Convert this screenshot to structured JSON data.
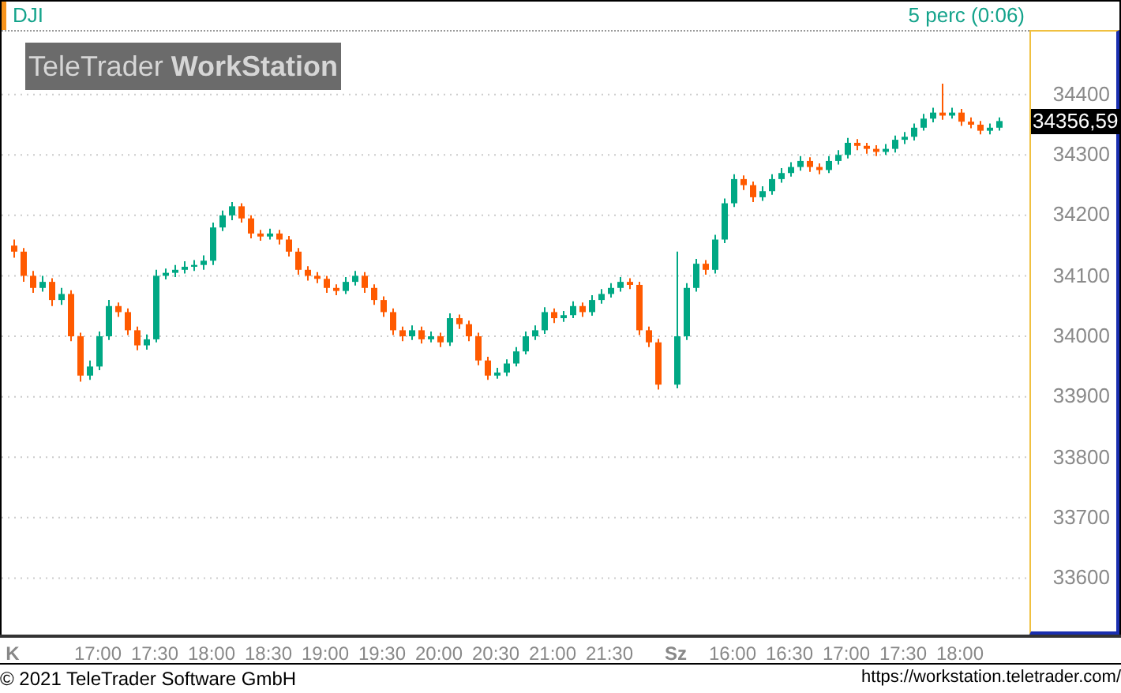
{
  "header": {
    "symbol": "DJI",
    "interval": "5 perc (0:06)"
  },
  "logo": {
    "brand": "TeleTrader",
    "product": "WorkStation"
  },
  "chart_data": {
    "type": "candlestick",
    "grid": true,
    "ylim": [
      33507,
      34504
    ],
    "categories": [
      "K",
      null,
      null,
      null,
      null,
      null,
      null,
      null,
      null,
      "17:00",
      null,
      null,
      null,
      null,
      null,
      "17:30",
      null,
      null,
      null,
      null,
      null,
      "18:00",
      null,
      null,
      null,
      null,
      null,
      "18:30",
      null,
      null,
      null,
      null,
      null,
      "19:00",
      null,
      null,
      null,
      null,
      null,
      "19:30",
      null,
      null,
      null,
      null,
      null,
      "20:00",
      null,
      null,
      null,
      null,
      null,
      "20:30",
      null,
      null,
      null,
      null,
      null,
      "21:00",
      null,
      null,
      null,
      null,
      null,
      "21:30",
      null,
      null,
      null,
      null,
      null,
      null,
      "Sz",
      null,
      null,
      null,
      null,
      null,
      "16:00",
      null,
      null,
      null,
      null,
      null,
      "16:30",
      null,
      null,
      null,
      null,
      null,
      "17:00",
      null,
      null,
      null,
      null,
      null,
      "17:30",
      null,
      null,
      null,
      null,
      null,
      "18:00",
      null,
      null,
      null,
      null
    ],
    "yticks": [
      {
        "value": 33600,
        "label": "33600"
      },
      {
        "value": 33700,
        "label": "33700"
      },
      {
        "value": 33800,
        "label": "33800"
      },
      {
        "value": 33900,
        "label": "33900"
      },
      {
        "value": 34000,
        "label": "34000"
      },
      {
        "value": 34100,
        "label": "34100"
      },
      {
        "value": 34200,
        "label": "34200"
      },
      {
        "value": 34300,
        "label": "34300"
      },
      {
        "value": 34400,
        "label": "34400"
      }
    ],
    "ohlc": [
      [
        34150,
        34160,
        34130,
        34140
      ],
      [
        34140,
        34146,
        34090,
        34100
      ],
      [
        34100,
        34108,
        34072,
        34080
      ],
      [
        34080,
        34100,
        34074,
        34090
      ],
      [
        34090,
        34096,
        34050,
        34060
      ],
      [
        34060,
        34080,
        34052,
        34070
      ],
      [
        34070,
        34076,
        33992,
        34000
      ],
      [
        34000,
        34006,
        33925,
        33935
      ],
      [
        33935,
        33960,
        33928,
        33950
      ],
      [
        33950,
        34008,
        33944,
        34000
      ],
      [
        34000,
        34060,
        33994,
        34050
      ],
      [
        34050,
        34056,
        34032,
        34040
      ],
      [
        34040,
        34046,
        34002,
        34010
      ],
      [
        34010,
        34016,
        33977,
        33985
      ],
      [
        33985,
        34003,
        33978,
        33995
      ],
      [
        33995,
        34110,
        33990,
        34100
      ],
      [
        34100,
        34112,
        34094,
        34105
      ],
      [
        34105,
        34118,
        34098,
        34110
      ],
      [
        34110,
        34124,
        34104,
        34115
      ],
      [
        34115,
        34126,
        34108,
        34118
      ],
      [
        34118,
        34134,
        34110,
        34125
      ],
      [
        34125,
        34188,
        34118,
        34180
      ],
      [
        34180,
        34208,
        34174,
        34200
      ],
      [
        34200,
        34222,
        34192,
        34215
      ],
      [
        34215,
        34220,
        34188,
        34195
      ],
      [
        34195,
        34200,
        34162,
        34170
      ],
      [
        34170,
        34176,
        34158,
        34165
      ],
      [
        34165,
        34178,
        34160,
        34170
      ],
      [
        34170,
        34176,
        34152,
        34160
      ],
      [
        34160,
        34166,
        34132,
        34140
      ],
      [
        34140,
        34146,
        34102,
        34110
      ],
      [
        34110,
        34116,
        34092,
        34100
      ],
      [
        34100,
        34106,
        34088,
        34095
      ],
      [
        34095,
        34100,
        34072,
        34080
      ],
      [
        34080,
        34086,
        34068,
        34075
      ],
      [
        34075,
        34098,
        34070,
        34090
      ],
      [
        34090,
        34108,
        34084,
        34100
      ],
      [
        34100,
        34106,
        34072,
        34080
      ],
      [
        34080,
        34086,
        34052,
        34060
      ],
      [
        34060,
        34066,
        34032,
        34040
      ],
      [
        34040,
        34046,
        34002,
        34010
      ],
      [
        34010,
        34016,
        33992,
        34000
      ],
      [
        34000,
        34018,
        33994,
        34010
      ],
      [
        34010,
        34016,
        33988,
        33995
      ],
      [
        33995,
        34008,
        33990,
        34000
      ],
      [
        34000,
        34006,
        33982,
        33990
      ],
      [
        33990,
        34038,
        33984,
        34030
      ],
      [
        34030,
        34036,
        34012,
        34020
      ],
      [
        34020,
        34026,
        33992,
        34000
      ],
      [
        34000,
        34006,
        33952,
        33960
      ],
      [
        33960,
        33966,
        33928,
        33935
      ],
      [
        33935,
        33948,
        33930,
        33940
      ],
      [
        33940,
        33962,
        33934,
        33955
      ],
      [
        33955,
        33982,
        33950,
        33975
      ],
      [
        33975,
        34008,
        33970,
        34000
      ],
      [
        34000,
        34018,
        33994,
        34010
      ],
      [
        34010,
        34048,
        34004,
        34040
      ],
      [
        34040,
        34046,
        34022,
        34030
      ],
      [
        34030,
        34042,
        34024,
        34035
      ],
      [
        34035,
        34058,
        34030,
        34050
      ],
      [
        34050,
        34056,
        34032,
        34040
      ],
      [
        34040,
        34068,
        34034,
        34060
      ],
      [
        34060,
        34078,
        34054,
        34070
      ],
      [
        34070,
        34088,
        34064,
        34080
      ],
      [
        34080,
        34098,
        34074,
        34090
      ],
      [
        34090,
        34096,
        34078,
        34085
      ],
      [
        34085,
        34090,
        34002,
        34010
      ],
      [
        34010,
        34016,
        33982,
        33990
      ],
      [
        33990,
        33996,
        33912,
        33920
      ],
      null,
      [
        33920,
        34140,
        33914,
        34000
      ],
      [
        34000,
        34088,
        33994,
        34080
      ],
      [
        34080,
        34128,
        34074,
        34120
      ],
      [
        34120,
        34126,
        34102,
        34110
      ],
      [
        34110,
        34168,
        34104,
        34160
      ],
      [
        34160,
        34228,
        34154,
        34220
      ],
      [
        34220,
        34268,
        34214,
        34260
      ],
      [
        34260,
        34266,
        34242,
        34250
      ],
      [
        34250,
        34256,
        34222,
        34230
      ],
      [
        34230,
        34248,
        34224,
        34240
      ],
      [
        34240,
        34268,
        34234,
        34260
      ],
      [
        34260,
        34278,
        34254,
        34270
      ],
      [
        34270,
        34288,
        34264,
        34280
      ],
      [
        34280,
        34298,
        34274,
        34290
      ],
      [
        34290,
        34296,
        34272,
        34280
      ],
      [
        34280,
        34286,
        34268,
        34275
      ],
      [
        34275,
        34298,
        34270,
        34290
      ],
      [
        34290,
        34308,
        34284,
        34300
      ],
      [
        34300,
        34328,
        34294,
        34320
      ],
      [
        34320,
        34326,
        34308,
        34315
      ],
      [
        34315,
        34320,
        34302,
        34310
      ],
      [
        34310,
        34316,
        34298,
        34305
      ],
      [
        34305,
        34318,
        34300,
        34310
      ],
      [
        34310,
        34332,
        34304,
        34325
      ],
      [
        34325,
        34338,
        34318,
        34330
      ],
      [
        34330,
        34352,
        34324,
        34345
      ],
      [
        34345,
        34368,
        34340,
        34360
      ],
      [
        34360,
        34378,
        34354,
        34370
      ],
      [
        34370,
        34418,
        34358,
        34365
      ],
      [
        34365,
        34378,
        34360,
        34370
      ],
      [
        34370,
        34376,
        34348,
        34355
      ],
      [
        34355,
        34362,
        34344,
        34350
      ],
      [
        34350,
        34356,
        34334,
        34340
      ],
      [
        34340,
        34352,
        34334,
        34345
      ],
      [
        34345,
        34362,
        34340,
        34356
      ]
    ]
  },
  "price_axis": {
    "current_price": "34356,59"
  },
  "footer": {
    "copyright": "© 2021 TeleTrader Software GmbH",
    "url": "https://workstation.teletrader.com/"
  }
}
